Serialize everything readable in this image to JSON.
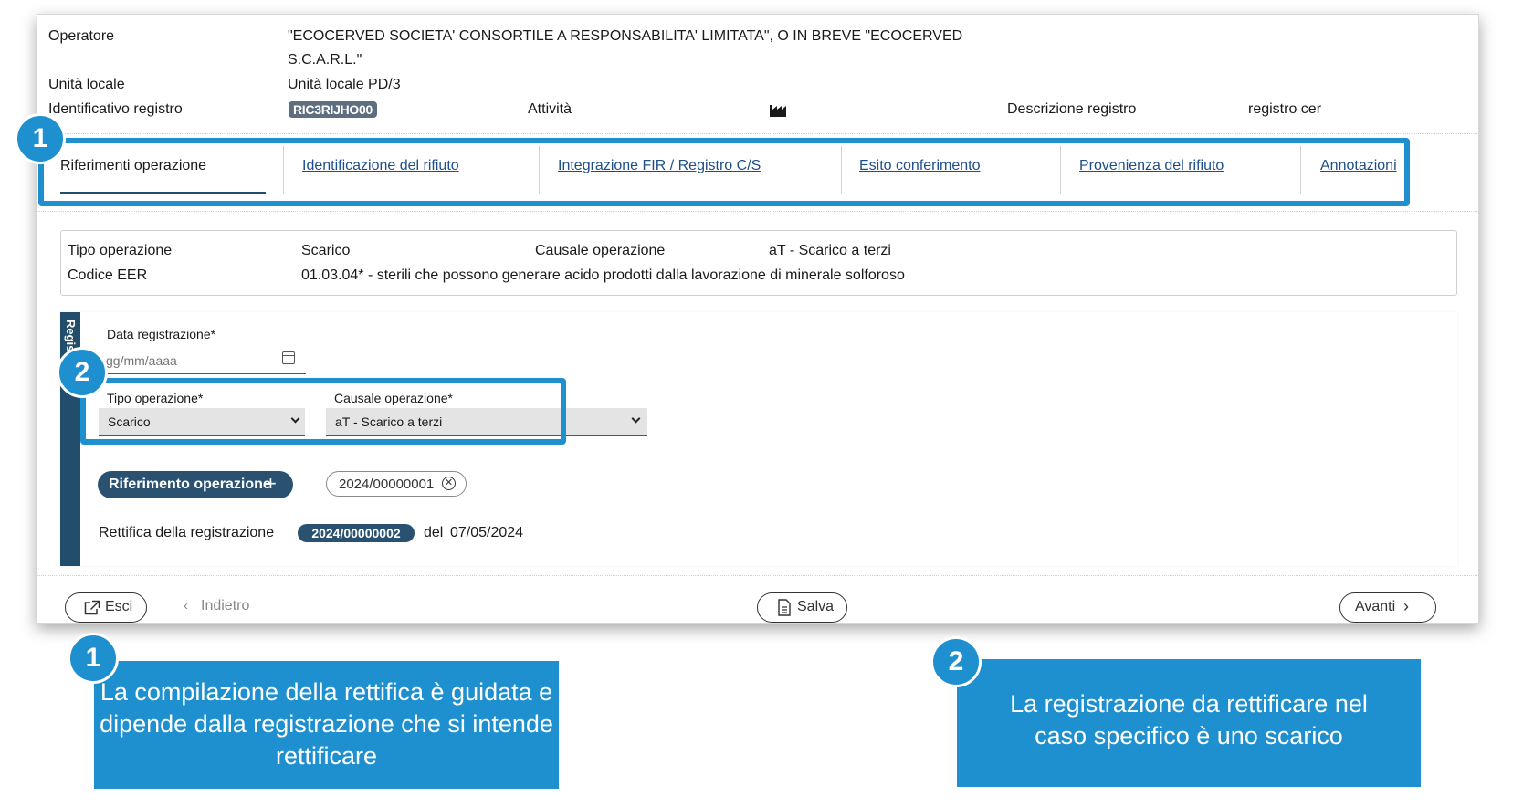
{
  "header": {
    "operatore_label": "Operatore",
    "operatore_line1": "\"ECOCERVED SOCIETA' CONSORTILE A RESPONSABILITA' LIMITATA\", O IN BREVE \"ECOCERVED",
    "operatore_line2": "S.C.A.R.L.\"",
    "unita_label": "Unità locale",
    "unita_value": "Unità locale PD/3",
    "registro_label": "Identificativo registro",
    "registro_value": "RIC3RIJHO00",
    "attivita_label": "Attività",
    "descrizione_label": "Descrizione registro",
    "descrizione_value": "registro cer"
  },
  "tabs": [
    {
      "label": "Riferimenti operazione",
      "active": true
    },
    {
      "label": "Identificazione del rifiuto",
      "active": false
    },
    {
      "label": "Integrazione FIR / Registro C/S",
      "active": false
    },
    {
      "label": "Esito conferimento",
      "active": false
    },
    {
      "label": "Provenienza del rifiuto",
      "active": false
    },
    {
      "label": "Annotazioni",
      "active": false
    }
  ],
  "summary": {
    "tipo_label": "Tipo operazione",
    "tipo_value": "Scarico",
    "causale_label": "Causale operazione",
    "causale_value": "aT - Scarico a terzi",
    "eer_label": "Codice EER",
    "eer_value": "01.03.04* - sterili che possono generare acido prodotti dalla lavorazione di minerale solforoso"
  },
  "form": {
    "side_tab": "Regis",
    "data_label": "Data registrazione*",
    "data_placeholder": "gg/mm/aaaa",
    "tipo_label": "Tipo operazione*",
    "tipo_selected": "Scarico",
    "causale_label": "Causale operazione*",
    "causale_selected": "aT - Scarico a terzi",
    "riferimento_button": "Riferimento operazione",
    "riferimento_chip": "2024/00000001",
    "rettifica_label": "Rettifica della registrazione",
    "rettifica_number": "2024/00000002",
    "rettifica_del": "del",
    "rettifica_date": "07/05/2024"
  },
  "footer": {
    "esci": "Esci",
    "indietro": "Indietro",
    "salva": "Salva",
    "avanti": "Avanti"
  },
  "annotations": {
    "badge1": "1",
    "badge2": "2",
    "callout1": "La compilazione della rettifica è guidata e dipende dalla registrazione che si intende rettificare",
    "callout2": "La registrazione da rettificare nel caso specifico è uno scarico"
  },
  "colors": {
    "accent_blue": "#1e90cf",
    "dark_navy": "#234e6b",
    "link_blue": "#1e4f8a"
  }
}
